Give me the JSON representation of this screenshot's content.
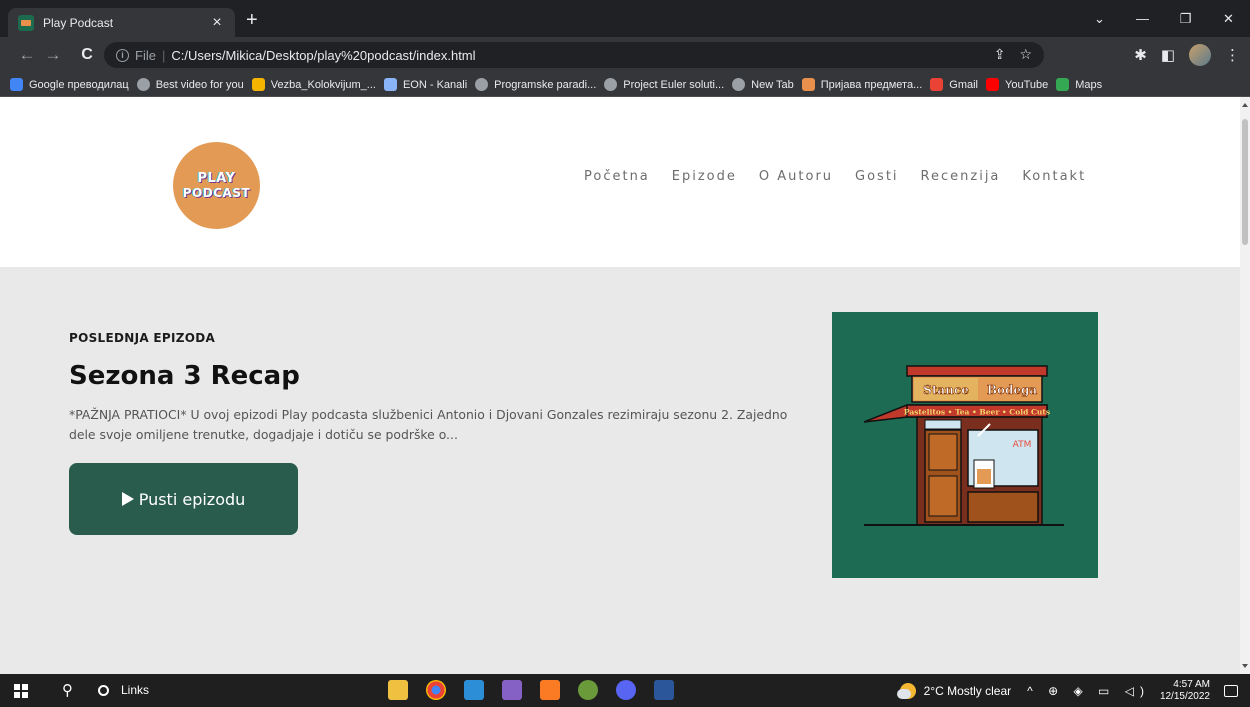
{
  "browser": {
    "tab_title": "Play Podcast",
    "tab_close": "×",
    "new_tab": "+",
    "omnibox_info": "i",
    "omnibox_file": "File",
    "omnibox_sep": "|",
    "url": "C:/Users/Mikica/Desktop/play%20podcast/index.html",
    "bookmarks": [
      {
        "label": "Google преводилац",
        "icon_color": "#4285f4"
      },
      {
        "label": "Best video for you",
        "icon_color": "#9aa0a6"
      },
      {
        "label": "Vezba_Kolokvijum_...",
        "icon_color": "#f4b400"
      },
      {
        "label": "EON - Kanali",
        "icon_color": "#8ab4f8"
      },
      {
        "label": "Programske paradi...",
        "icon_color": "#9aa0a6"
      },
      {
        "label": "Project Euler soluti...",
        "icon_color": "#9aa0a6"
      },
      {
        "label": "New Tab",
        "icon_color": "#9aa0a6"
      },
      {
        "label": "Пријава предмета...",
        "icon_color": "#e8904c"
      },
      {
        "label": "Gmail",
        "icon_color": "#ea4335"
      },
      {
        "label": "YouTube",
        "icon_color": "#ff0000"
      },
      {
        "label": "Maps",
        "icon_color": "#34a853"
      }
    ]
  },
  "site": {
    "logo_line1": "PLAY",
    "logo_line2": "PODCAST",
    "nav": [
      "Početna",
      "Epizode",
      "O Autoru",
      "Gosti",
      "Recenzija",
      "Kontakt"
    ]
  },
  "hero": {
    "kicker": "POSLEDNJA EPIZODA",
    "title": "Sezona 3 Recap",
    "description": "*PAŽNJA PRATIOCI* U ovoj epizodi Play podcasta službenici Antonio i Djovani Gonzales rezimiraju sezonu 2. Zajedno dele svoje omiljene trenutke, dogadjaje i dotiču se podrške o...",
    "play_button": "Pusti epizodu",
    "cover_sign_left": "Stance",
    "cover_sign_right": "Bodega",
    "cover_awning": "Pastelitos • Tea • Beer • Cold Cuts",
    "cover_window": "ATM"
  },
  "taskbar": {
    "links_label": "Links",
    "weather": "2°C  Mostly clear",
    "time": "4:57 AM",
    "date": "12/15/2022"
  },
  "colors": {
    "accent_green": "#2a5c4e",
    "cover_bg": "#1d6b52",
    "logo_orange": "#e39a55",
    "hero_bg": "#e9e9e9"
  }
}
